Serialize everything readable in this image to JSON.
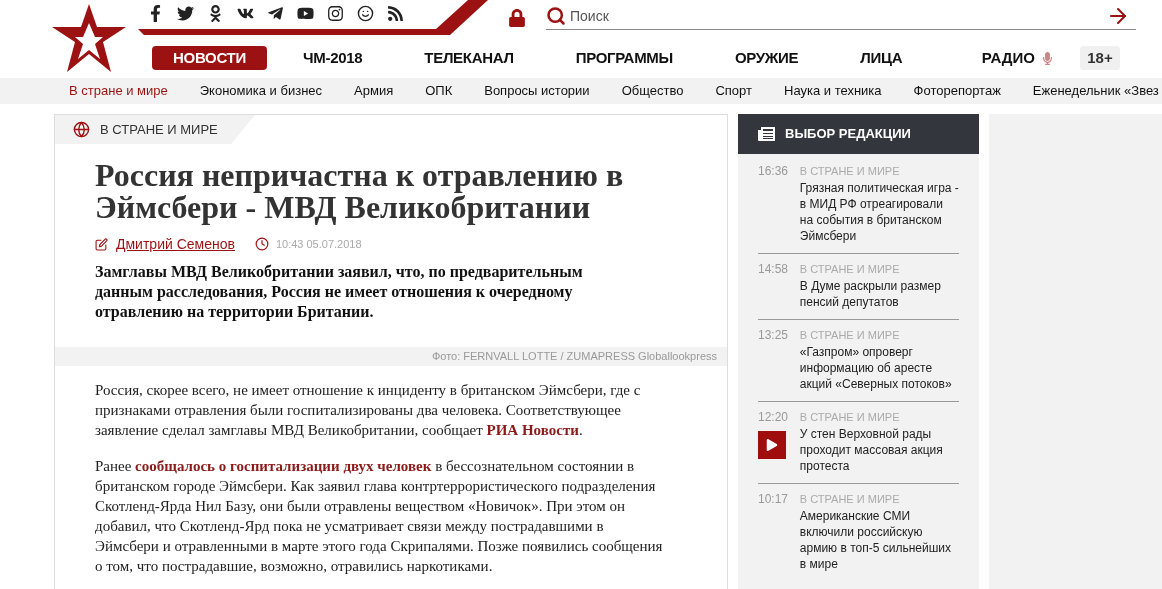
{
  "header": {
    "search": {
      "placeholder": "Поиск"
    },
    "nav": [
      {
        "label": "НОВОСТИ",
        "selected": true
      },
      {
        "label": "ЧМ-2018",
        "selected": false
      },
      {
        "label": "ТЕЛЕКАНАЛ",
        "selected": false
      },
      {
        "label": "ПРОГРАММЫ",
        "selected": false
      },
      {
        "label": "ОРУЖИЕ",
        "selected": false
      },
      {
        "label": "ЛИЦА",
        "selected": false
      }
    ],
    "radio": "РАДИО",
    "age": "18+"
  },
  "subnav": [
    {
      "label": "В стране и мире",
      "selected": true
    },
    {
      "label": "Экономика и бизнес",
      "selected": false
    },
    {
      "label": "Армия",
      "selected": false
    },
    {
      "label": "ОПК",
      "selected": false
    },
    {
      "label": "Вопросы истории",
      "selected": false
    },
    {
      "label": "Общество",
      "selected": false
    },
    {
      "label": "Спорт",
      "selected": false
    },
    {
      "label": "Наука и техника",
      "selected": false
    },
    {
      "label": "Фоторепортаж",
      "selected": false
    },
    {
      "label": "Еженедельник «Звез",
      "selected": false
    }
  ],
  "article": {
    "category": "В СТРАНЕ И МИРЕ",
    "title": "Россия непричастна к отравлению в Эймсбери - МВД Великобритании",
    "author": "Дмитрий Семенов",
    "time": "10:43 05.07.2018",
    "lead": "Замглавы МВД Великобритании заявил, что, по предварительным данным расследования, Россия не имеет отношения к очередному отравлению на территории Британии.",
    "photo_credit": "Фото: FERNVALL LOTTE / ZUMAPRESS Globallookpress",
    "paragraphs": [
      [
        {
          "text": "Россия, скорее всего, не имеет отношение к инциденту в британском Эймсбери, где с признаками отравления были госпитализированы два человека. Соответствующее заявление сделал замглавы МВД Великобритании, сообщает ",
          "link": false
        },
        {
          "text": "РИА Новости",
          "link": true
        },
        {
          "text": ".",
          "link": false
        }
      ],
      [
        {
          "text": "Ранее ",
          "link": false
        },
        {
          "text": "сообщалось о госпитализации двух человек",
          "link": true
        },
        {
          "text": " в бессознательном состоянии в британском городе Эймсбери. Как заявил глава контртеррористического подразделения Скотленд-Ярда Нил Базу, они были отравлены веществом «Новичок». При этом он добавил, что Скотленд-Ярд пока не усматривает связи между пострадавшими в Эймсбери и отравленными в марте этого года Скрипалями. Позже появились сообщения о том, что пострадавшие, возможно, отравились наркотиками.",
          "link": false
        }
      ]
    ]
  },
  "editors_choice": {
    "title": "ВЫБОР РЕДАКЦИИ",
    "items": [
      {
        "time": "16:36",
        "category": "В СТРАНЕ И МИРЕ",
        "title": "Грязная политическая игра - в МИД РФ отреагировали на события в британском Эймсбери",
        "kind": "text"
      },
      {
        "time": "14:58",
        "category": "В СТРАНЕ И МИРЕ",
        "title": "В Думе раскрыли размер пенсий депутатов",
        "kind": "text"
      },
      {
        "time": "13:25",
        "category": "В СТРАНЕ И МИРЕ",
        "title": "«Газпром» опроверг информацию об аресте акций «Северных потоков»",
        "kind": "text"
      },
      {
        "time": "12:20",
        "category": "В СТРАНЕ И МИРЕ",
        "title": "У стен Верховной рады проходит массовая акция протеста",
        "kind": "video"
      },
      {
        "time": "10:17",
        "category": "В СТРАНЕ И МИРЕ",
        "title": "Американские СМИ включили российскую армию в топ-5 сильнейших в мире",
        "kind": "text"
      }
    ]
  }
}
